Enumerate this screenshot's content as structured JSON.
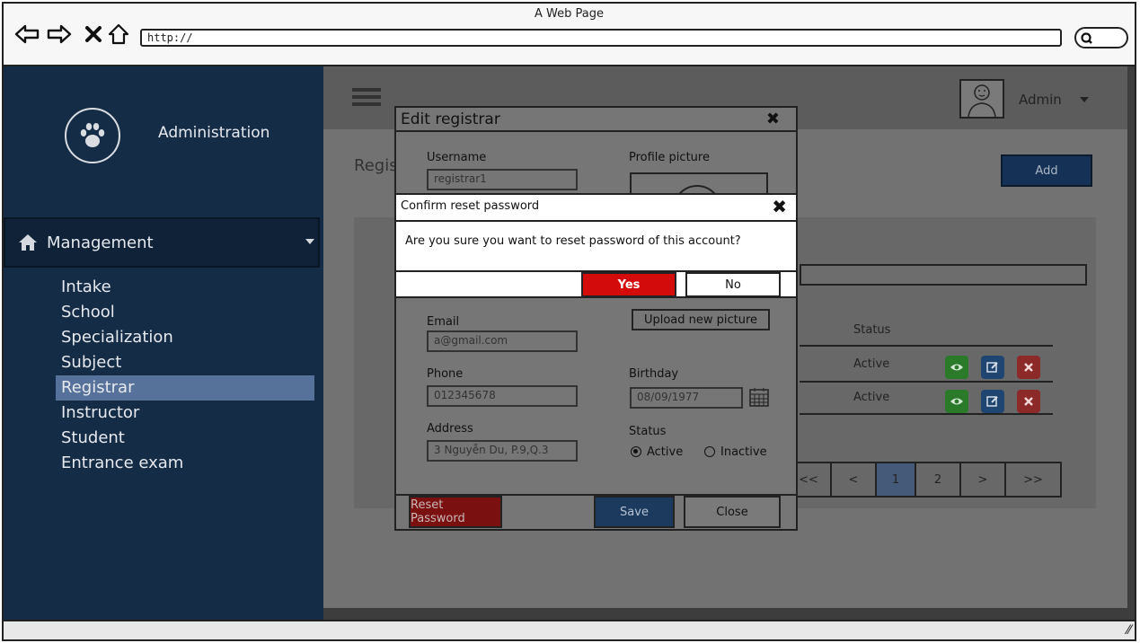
{
  "browser": {
    "window_title": "A Web Page",
    "url": "http://"
  },
  "sidebar": {
    "brand_name": "Administration",
    "section_label": "Management",
    "items": [
      {
        "label": "Intake"
      },
      {
        "label": "School"
      },
      {
        "label": "Specialization"
      },
      {
        "label": "Subject"
      },
      {
        "label": "Registrar"
      },
      {
        "label": "Instructor"
      },
      {
        "label": "Student"
      },
      {
        "label": "Entrance exam"
      }
    ],
    "active_item": "Registrar"
  },
  "header": {
    "user_name": "Admin"
  },
  "main": {
    "page_title": "Regis",
    "add_label": "Add",
    "table": {
      "status_header": "Status",
      "rows": [
        {
          "status": "Active"
        },
        {
          "status": "Active"
        }
      ]
    },
    "pagination": [
      "<<",
      "<",
      "1",
      "2",
      ">",
      ">>"
    ],
    "current_page": "1"
  },
  "edit_dialog": {
    "title": "Edit registrar",
    "username_label": "Username",
    "username_value": "registrar1",
    "profile_picture_label": "Profile picture",
    "email_label": "Email",
    "email_value": "a@gmail.com",
    "upload_label": "Upload new picture",
    "phone_label": "Phone",
    "phone_value": "012345678",
    "birthday_label": "Birthday",
    "birthday_value": "08/09/1977",
    "address_label": "Address",
    "address_value": "3 Nguyễn Du, P.9,Q.3",
    "status_label": "Status",
    "status_options": [
      "Active",
      "Inactive"
    ],
    "status_selected": "Active",
    "reset_label": "Reset Password",
    "save_label": "Save",
    "close_label": "Close"
  },
  "confirm_dialog": {
    "title": "Confirm reset password",
    "message": "Are you sure you want to reset password of this account?",
    "yes_label": "Yes",
    "no_label": "No"
  },
  "colors": {
    "sidebar_bg": "#152c47",
    "active_item": "#56719a",
    "primary": "#153256",
    "danger": "#d40b0b",
    "success": "#2aa82a"
  }
}
